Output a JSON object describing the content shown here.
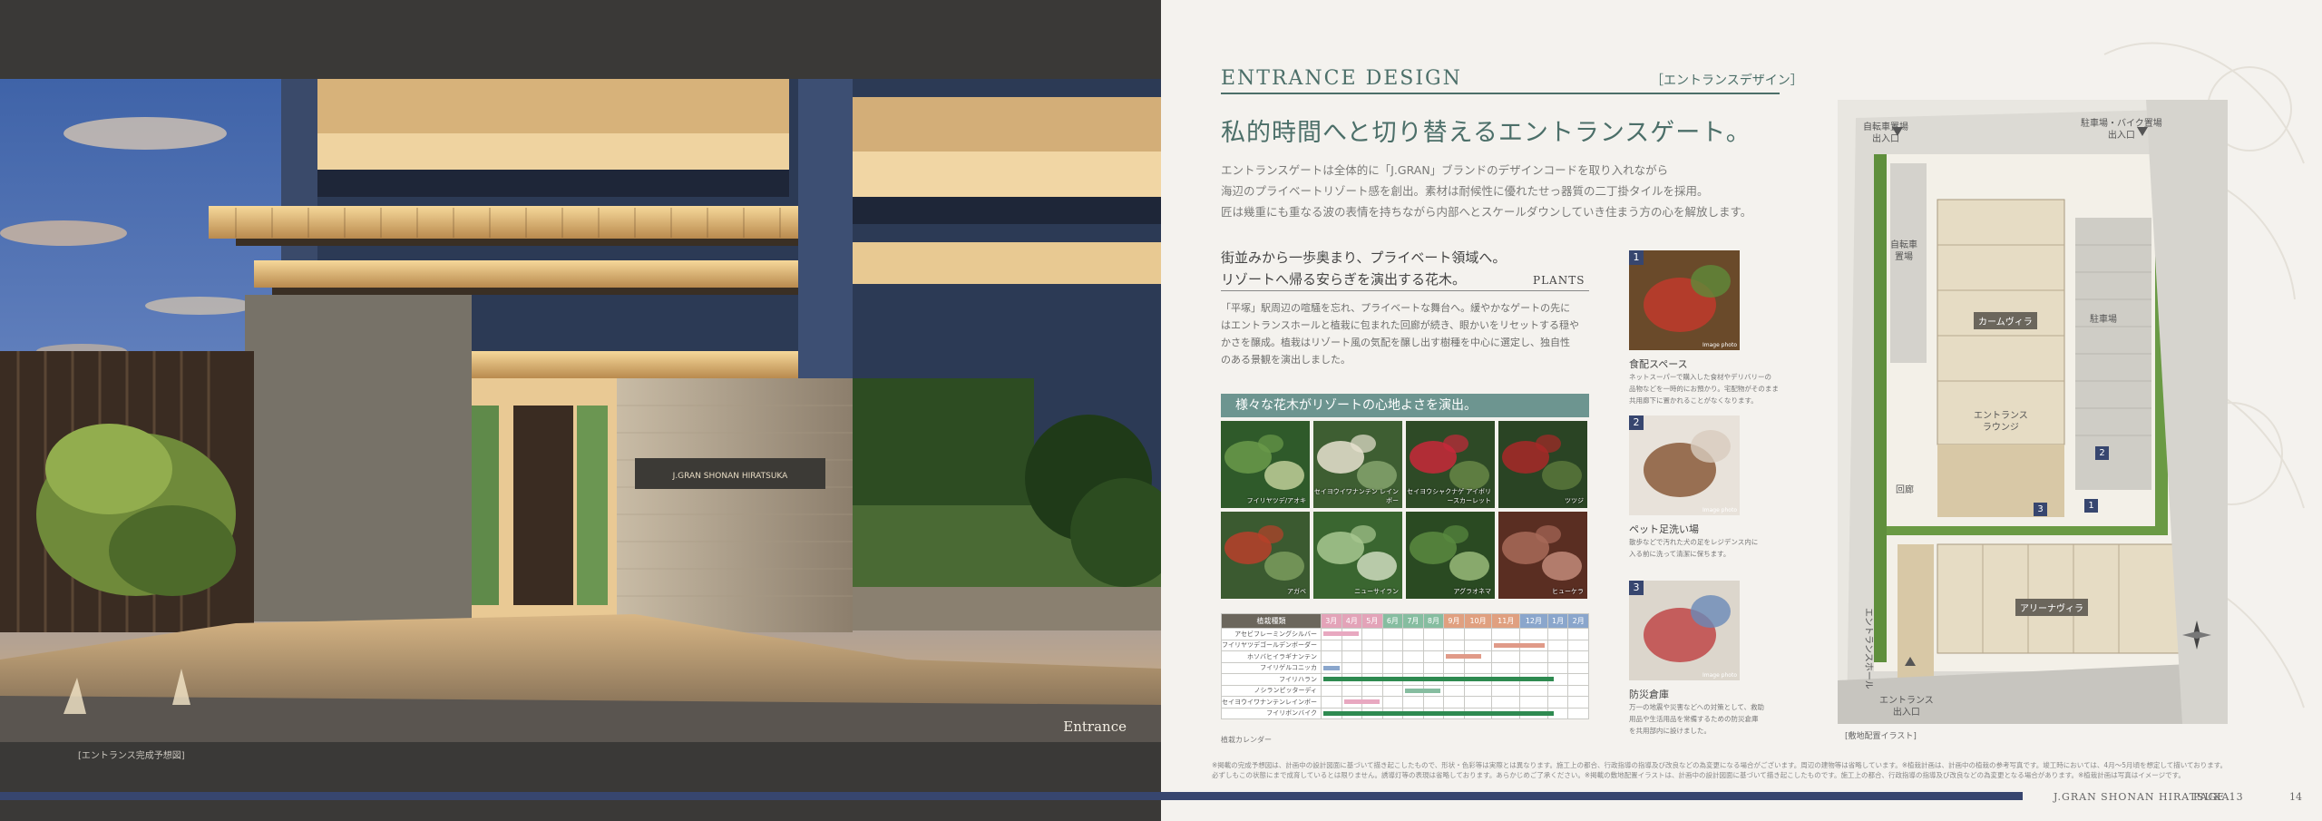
{
  "left_page": {
    "hero_caption": "Entrance",
    "note": "[エントランス完成予想図]",
    "sign_text": "J.GRAN SHONAN HIRATSUKA"
  },
  "section": {
    "title_en": "ENTRANCE DESIGN",
    "title_jp": "［エントランスデザイン］"
  },
  "headline": "私的時間へと切り替えるエントランスゲート。",
  "lead": [
    "エントランスゲートは全体的に「J.GRAN」ブランドのデザインコードを取り入れながら",
    "海辺のプライベートリゾート感を創出。素材は耐候性に優れたせっ器質の二丁掛タイルを採用。",
    "匠は幾重にも重なる波の表情を持ちながら内部へとスケールダウンしていき住まう方の心を解放します。"
  ],
  "plants": {
    "subhead": [
      "街並みから一歩奥まり、プライベート領域へ。",
      "リゾートへ帰る安らぎを演出する花木。"
    ],
    "tag": "PLANTS",
    "body": [
      "「平塚」駅周辺の喧騒を忘れ、プライベートな舞台へ。緩やかなゲートの先に",
      "はエントランスホールと植栽に包まれた回廊が続き、眼かいをリセットする穏や",
      "かさを醸成。植栽はリゾート風の気配を醸し出す樹種を中心に選定し、独自性",
      "のある景観を演出しました。"
    ],
    "banner": "様々な花木がリゾートの心地よさを演出。",
    "photos": [
      {
        "label": "フイリヤツデ/アオキ",
        "colors": [
          "#2f5a2a",
          "#6a9a4a",
          "#c9d6a0"
        ]
      },
      {
        "label": "セイヨウイワナンテン レインボー",
        "colors": [
          "#3e5e32",
          "#e8e2d0",
          "#8aa870"
        ]
      },
      {
        "label": "セイヨウシャクナゲ アイボリースカーレット",
        "colors": [
          "#2e4a26",
          "#c8283a",
          "#6a8a48"
        ]
      },
      {
        "label": "ツツジ",
        "colors": [
          "#2a4424",
          "#a82828",
          "#5c7a3c"
        ]
      },
      {
        "label": "アガベ",
        "colors": [
          "#3b5a30",
          "#b8402a",
          "#7fa060"
        ]
      },
      {
        "label": "ニューサイラン",
        "colors": [
          "#3a6630",
          "#a8c890",
          "#d8e4c8"
        ]
      },
      {
        "label": "アグラオネマ",
        "colors": [
          "#2a4a22",
          "#5a8a40",
          "#a0c080"
        ]
      },
      {
        "label": "ヒューケラ",
        "colors": [
          "#5a2e22",
          "#a86a58",
          "#c89080"
        ]
      }
    ],
    "calendar": {
      "header_label": "植栽種類",
      "months": [
        "3月",
        "4月",
        "5月",
        "6月",
        "7月",
        "8月",
        "9月",
        "10月",
        "11月",
        "12月",
        "1月",
        "2月"
      ],
      "month_colors": [
        "#e3a3b8",
        "#e3a3b8",
        "#e3a3b8",
        "#86bda0",
        "#86bda0",
        "#86bda0",
        "#e0a080",
        "#e0a080",
        "#e0a080",
        "#8aa6cc",
        "#8aa6cc",
        "#8aa6cc"
      ],
      "rows": [
        {
          "name": "アセビフレーミングシルバー",
          "start": 0,
          "end": 2,
          "color": "#e8a8c0"
        },
        {
          "name": "フイリヤツデゴールデンボーダー",
          "start": 8,
          "end": 10,
          "color": "#e09a88"
        },
        {
          "name": "ホソバヒイラギナンテン",
          "start": 6,
          "end": 8,
          "color": "#e09a88"
        },
        {
          "name": "フイリゲルコニッカ",
          "start": 0,
          "end": 1,
          "color": "#8aa6cc"
        },
        {
          "name": "フイリハラン",
          "start": 0,
          "end": 12,
          "color": "#2e8a50"
        },
        {
          "name": "ノシランピッターディ",
          "start": 4,
          "end": 6,
          "color": "#86bda0"
        },
        {
          "name": "セイヨウイワナンテンレインボー",
          "start": 1,
          "end": 3,
          "color": "#e8a8c0"
        },
        {
          "name": "フイリボンバイク",
          "start": 0,
          "end": 12,
          "color": "#2e8a50"
        }
      ],
      "note": "植栽カレンダー"
    }
  },
  "features": [
    {
      "num": "1",
      "title": "食配スペース",
      "desc": [
        "ネットスーパーで購入した食材やデリバリーの",
        "品物などを一時的にお預かり。宅配物がそのまま",
        "共用廊下に置かれることがなくなります。"
      ],
      "img_note": "Image photo"
    },
    {
      "num": "2",
      "title": "ペット足洗い場",
      "desc": [
        "散歩などで汚れた犬の足をレジデンス内に",
        "入る前に洗って清潔に保ちます。"
      ],
      "img_note": "Image photo"
    },
    {
      "num": "3",
      "title": "防災倉庫",
      "desc": [
        "万一の地震や災害などへの対策として、救助",
        "用品や生活用品を常備するための防災倉庫",
        "を共用部内に設けました。"
      ],
      "img_note": "Image photo"
    }
  ],
  "map": {
    "caption": "[敷地配置イラスト]",
    "labels": {
      "bike_entrance": "自転車置場\n出入口",
      "parking_entrance": "駐車場・バイク置場\n出入口",
      "bike_yard": "自転車\n置場",
      "parking": "駐車場",
      "lounge": "エントランス\nラウンジ",
      "kairou": "回廊",
      "hall": "エントランスホール",
      "entrance": "エントランス\n出入口"
    },
    "building_north": "カームヴィラ",
    "building_south": "アリーナヴィラ",
    "numbers": [
      "1",
      "2",
      "3"
    ]
  },
  "footnote": [
    "※掲載の完成予想図は、計画中の設計図面に基づいて描き起こしたもので、形状・色彩等は実際とは異なります。施工上の都合、行政指導の指導及び改良などの為変更になる場合がございます。周辺の建物等は省略しています。※植栽計画は、計画中の植栽の参考写真です。竣工時においては、4月〜5月頃を想定して描いております。",
    "必ずしもこの状態にまで成育しているとは限りません。誘導灯等の表現は省略しております。あらかじめご了承ください。※掲載の敷地配置イラストは、計画中の設計図面に基づいて描き起こしたものです。施工上の都合、行政指導の指導及び改良などの為変更となる場合があります。※植栽計画は写真はイメージです。"
  ],
  "footer": {
    "brand": "J.GRAN SHONAN HIRATSUKA",
    "page_left": "PAGE 13",
    "page_right": "14"
  }
}
